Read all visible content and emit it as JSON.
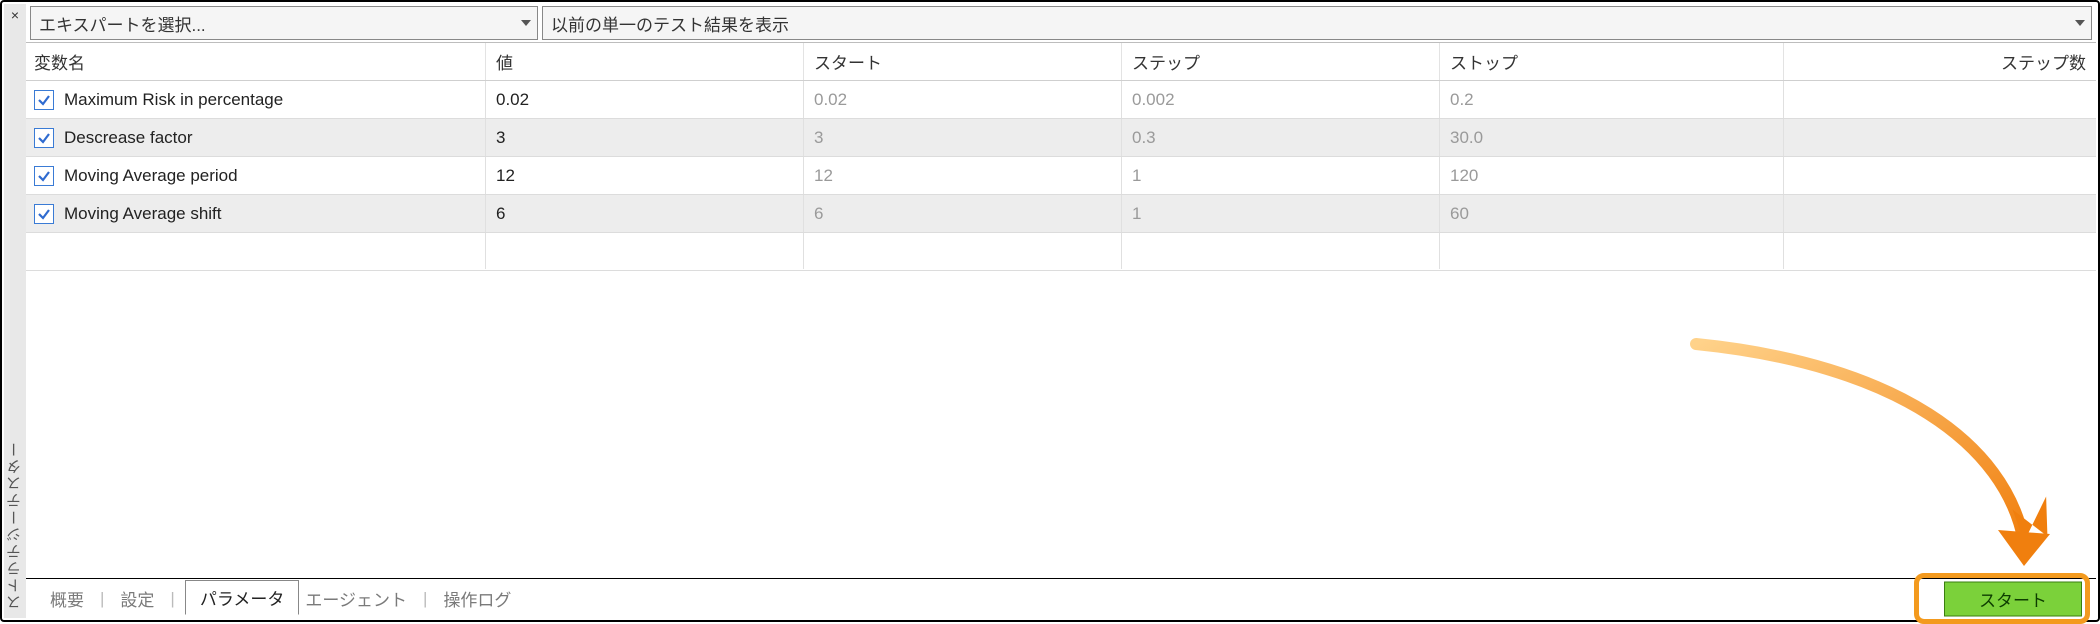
{
  "gutter": {
    "title": "ストラテジーテスター",
    "close": "×"
  },
  "dropdowns": {
    "expert_placeholder": "エキスパートを選択...",
    "results_label": "以前の単一のテスト結果を表示"
  },
  "columns": {
    "name": "変数名",
    "value": "値",
    "start": "スタート",
    "step": "ステップ",
    "stop": "ストップ",
    "count": "ステップ数"
  },
  "rows": [
    {
      "checked": true,
      "name": "Maximum Risk in percentage",
      "value": "0.02",
      "start": "0.02",
      "step": "0.002",
      "stop": "0.2",
      "count": ""
    },
    {
      "checked": true,
      "name": "Descrease factor",
      "value": "3",
      "start": "3",
      "step": "0.3",
      "stop": "30.0",
      "count": ""
    },
    {
      "checked": true,
      "name": "Moving Average period",
      "value": "12",
      "start": "12",
      "step": "1",
      "stop": "120",
      "count": ""
    },
    {
      "checked": true,
      "name": "Moving Average shift",
      "value": "6",
      "start": "6",
      "step": "1",
      "stop": "60",
      "count": ""
    }
  ],
  "tabs": {
    "overview": "概要",
    "settings": "設定",
    "parameters": "パラメータ",
    "agents": "エージェント",
    "log": "操作ログ"
  },
  "start_button": "スタート"
}
